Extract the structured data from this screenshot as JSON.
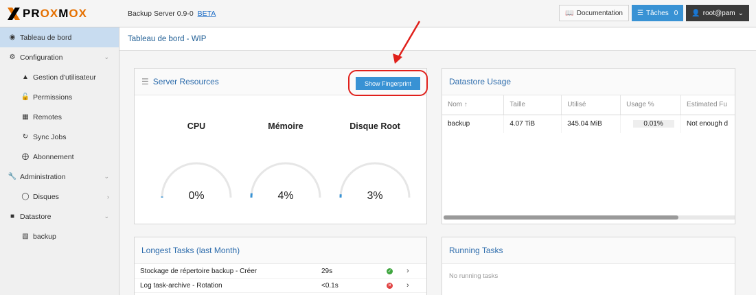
{
  "header": {
    "brand_pre": "PR",
    "brand_ox1": "OX",
    "brand_m": "M",
    "brand_ox2": "OX",
    "product": "Backup Server 0.9-0",
    "beta": "BETA",
    "documentation_label": "Documentation",
    "tasks_label": "Tâches",
    "tasks_count": "0",
    "user_label": "root@pam"
  },
  "sidebar": {
    "items": [
      {
        "label": "Tableau de bord",
        "icon": "dashboard-icon"
      },
      {
        "label": "Configuration",
        "icon": "gears-icon"
      },
      {
        "label": "Gestion d'utilisateur",
        "icon": "user-icon"
      },
      {
        "label": "Permissions",
        "icon": "unlock-icon"
      },
      {
        "label": "Remotes",
        "icon": "server-icon"
      },
      {
        "label": "Sync Jobs",
        "icon": "refresh-icon"
      },
      {
        "label": "Abonnement",
        "icon": "support-icon"
      },
      {
        "label": "Administration",
        "icon": "wrench-icon"
      },
      {
        "label": "Disques",
        "icon": "disk-icon"
      },
      {
        "label": "Datastore",
        "icon": "archive-icon"
      },
      {
        "label": "backup",
        "icon": "database-icon"
      }
    ]
  },
  "main": {
    "title": "Tableau de bord - WIP"
  },
  "server_resources": {
    "title": "Server Resources",
    "fingerprint_button": "Show Fingerprint",
    "gauges": [
      {
        "label": "CPU",
        "value": "0%",
        "fraction": 0.0
      },
      {
        "label": "Mémoire",
        "value": "4%",
        "fraction": 0.04
      },
      {
        "label": "Disque Root",
        "value": "3%",
        "fraction": 0.03
      }
    ]
  },
  "datastore_usage": {
    "title": "Datastore Usage",
    "columns": [
      "Nom ↑",
      "Taille",
      "Utilisé",
      "Usage %",
      "Estimated Fu"
    ],
    "rows": [
      [
        "backup",
        "4.07 TiB",
        "345.04 MiB",
        "0.01%",
        "Not enough d"
      ]
    ]
  },
  "longest_tasks": {
    "title": "Longest Tasks (last Month)",
    "rows": [
      {
        "name": "Stockage de répertoire backup - Créer",
        "duration": "29s",
        "status": "ok"
      },
      {
        "name": "Log task-archive - Rotation",
        "duration": "<0.1s",
        "status": "error"
      }
    ]
  },
  "running_tasks": {
    "title": "Running Tasks",
    "empty": "No running tasks"
  },
  "colors": {
    "accent": "#3892d4",
    "brand_orange": "#e57000",
    "annotation_red": "#e0201b",
    "gauge_track": "#e6e6e6"
  }
}
